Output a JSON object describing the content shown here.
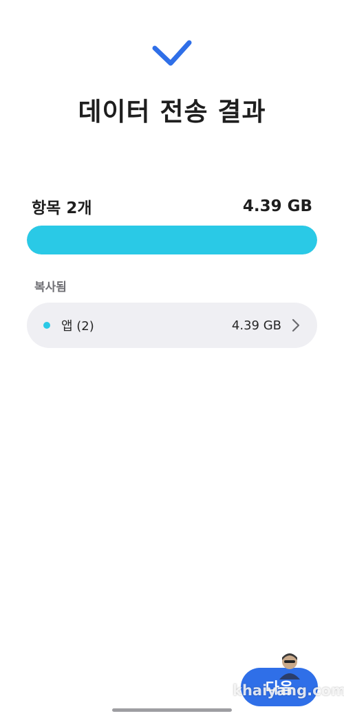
{
  "header": {
    "icon": "check-icon",
    "title": "데이터 전송 결과"
  },
  "summary": {
    "count_label": "항목 2개",
    "total_size": "4.39 GB",
    "progress_fraction": 1.0
  },
  "copied_section": {
    "label": "복사됨",
    "items": [
      {
        "name": "앱 (2)",
        "size": "4.39 GB",
        "dot_color": "#2ac9e6",
        "icon": "chevron-right-icon"
      }
    ]
  },
  "footer": {
    "next_label": "다음",
    "watermark": "khaiyang.com"
  },
  "colors": {
    "accent": "#2f6fe8",
    "progress": "#2ac9e6"
  }
}
